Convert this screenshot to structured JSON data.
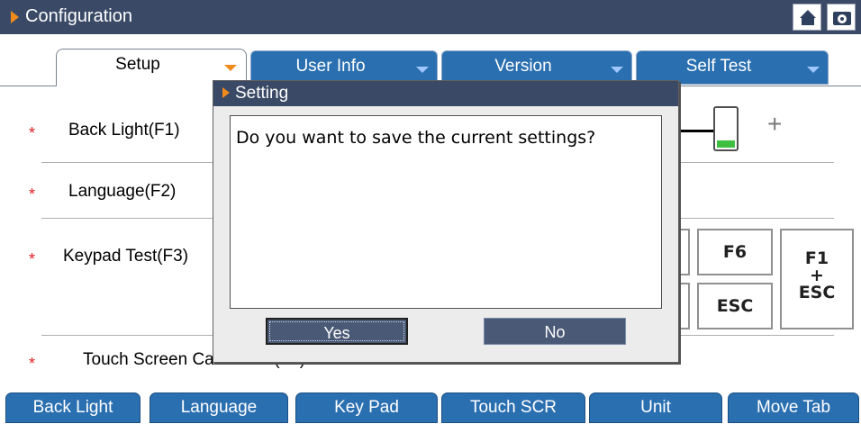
{
  "window": {
    "title": "Configuration"
  },
  "tabs": [
    {
      "label": "Setup",
      "active": true
    },
    {
      "label": "User Info",
      "active": false
    },
    {
      "label": "Version",
      "active": false
    },
    {
      "label": "Self Test",
      "active": false
    }
  ],
  "settings": {
    "back_light": "Back Light(F1)",
    "language": "Language(F2)",
    "keypad_test": "Keypad Test(F3)",
    "touch_screen": "Touch Screen Calibration(F4)",
    "required_mark": "*",
    "plus": "+"
  },
  "keys": {
    "f6": "F6",
    "esc": "ESC",
    "combo_top": "F1",
    "combo_mid": "+",
    "combo_bottom": "ESC"
  },
  "dialog": {
    "title": "Setting",
    "message": "Do you want to save the current settings?",
    "yes_label": "Yes",
    "no_label": "No"
  },
  "bottom_bar": [
    "Back Light",
    "Language",
    "Key Pad",
    "Touch SCR",
    "Unit",
    "Move Tab"
  ],
  "colors": {
    "title_bg": "#3a4a66",
    "accent": "#f08a1c",
    "tab_blue": "#2a6fb0",
    "star": "#e02020"
  }
}
